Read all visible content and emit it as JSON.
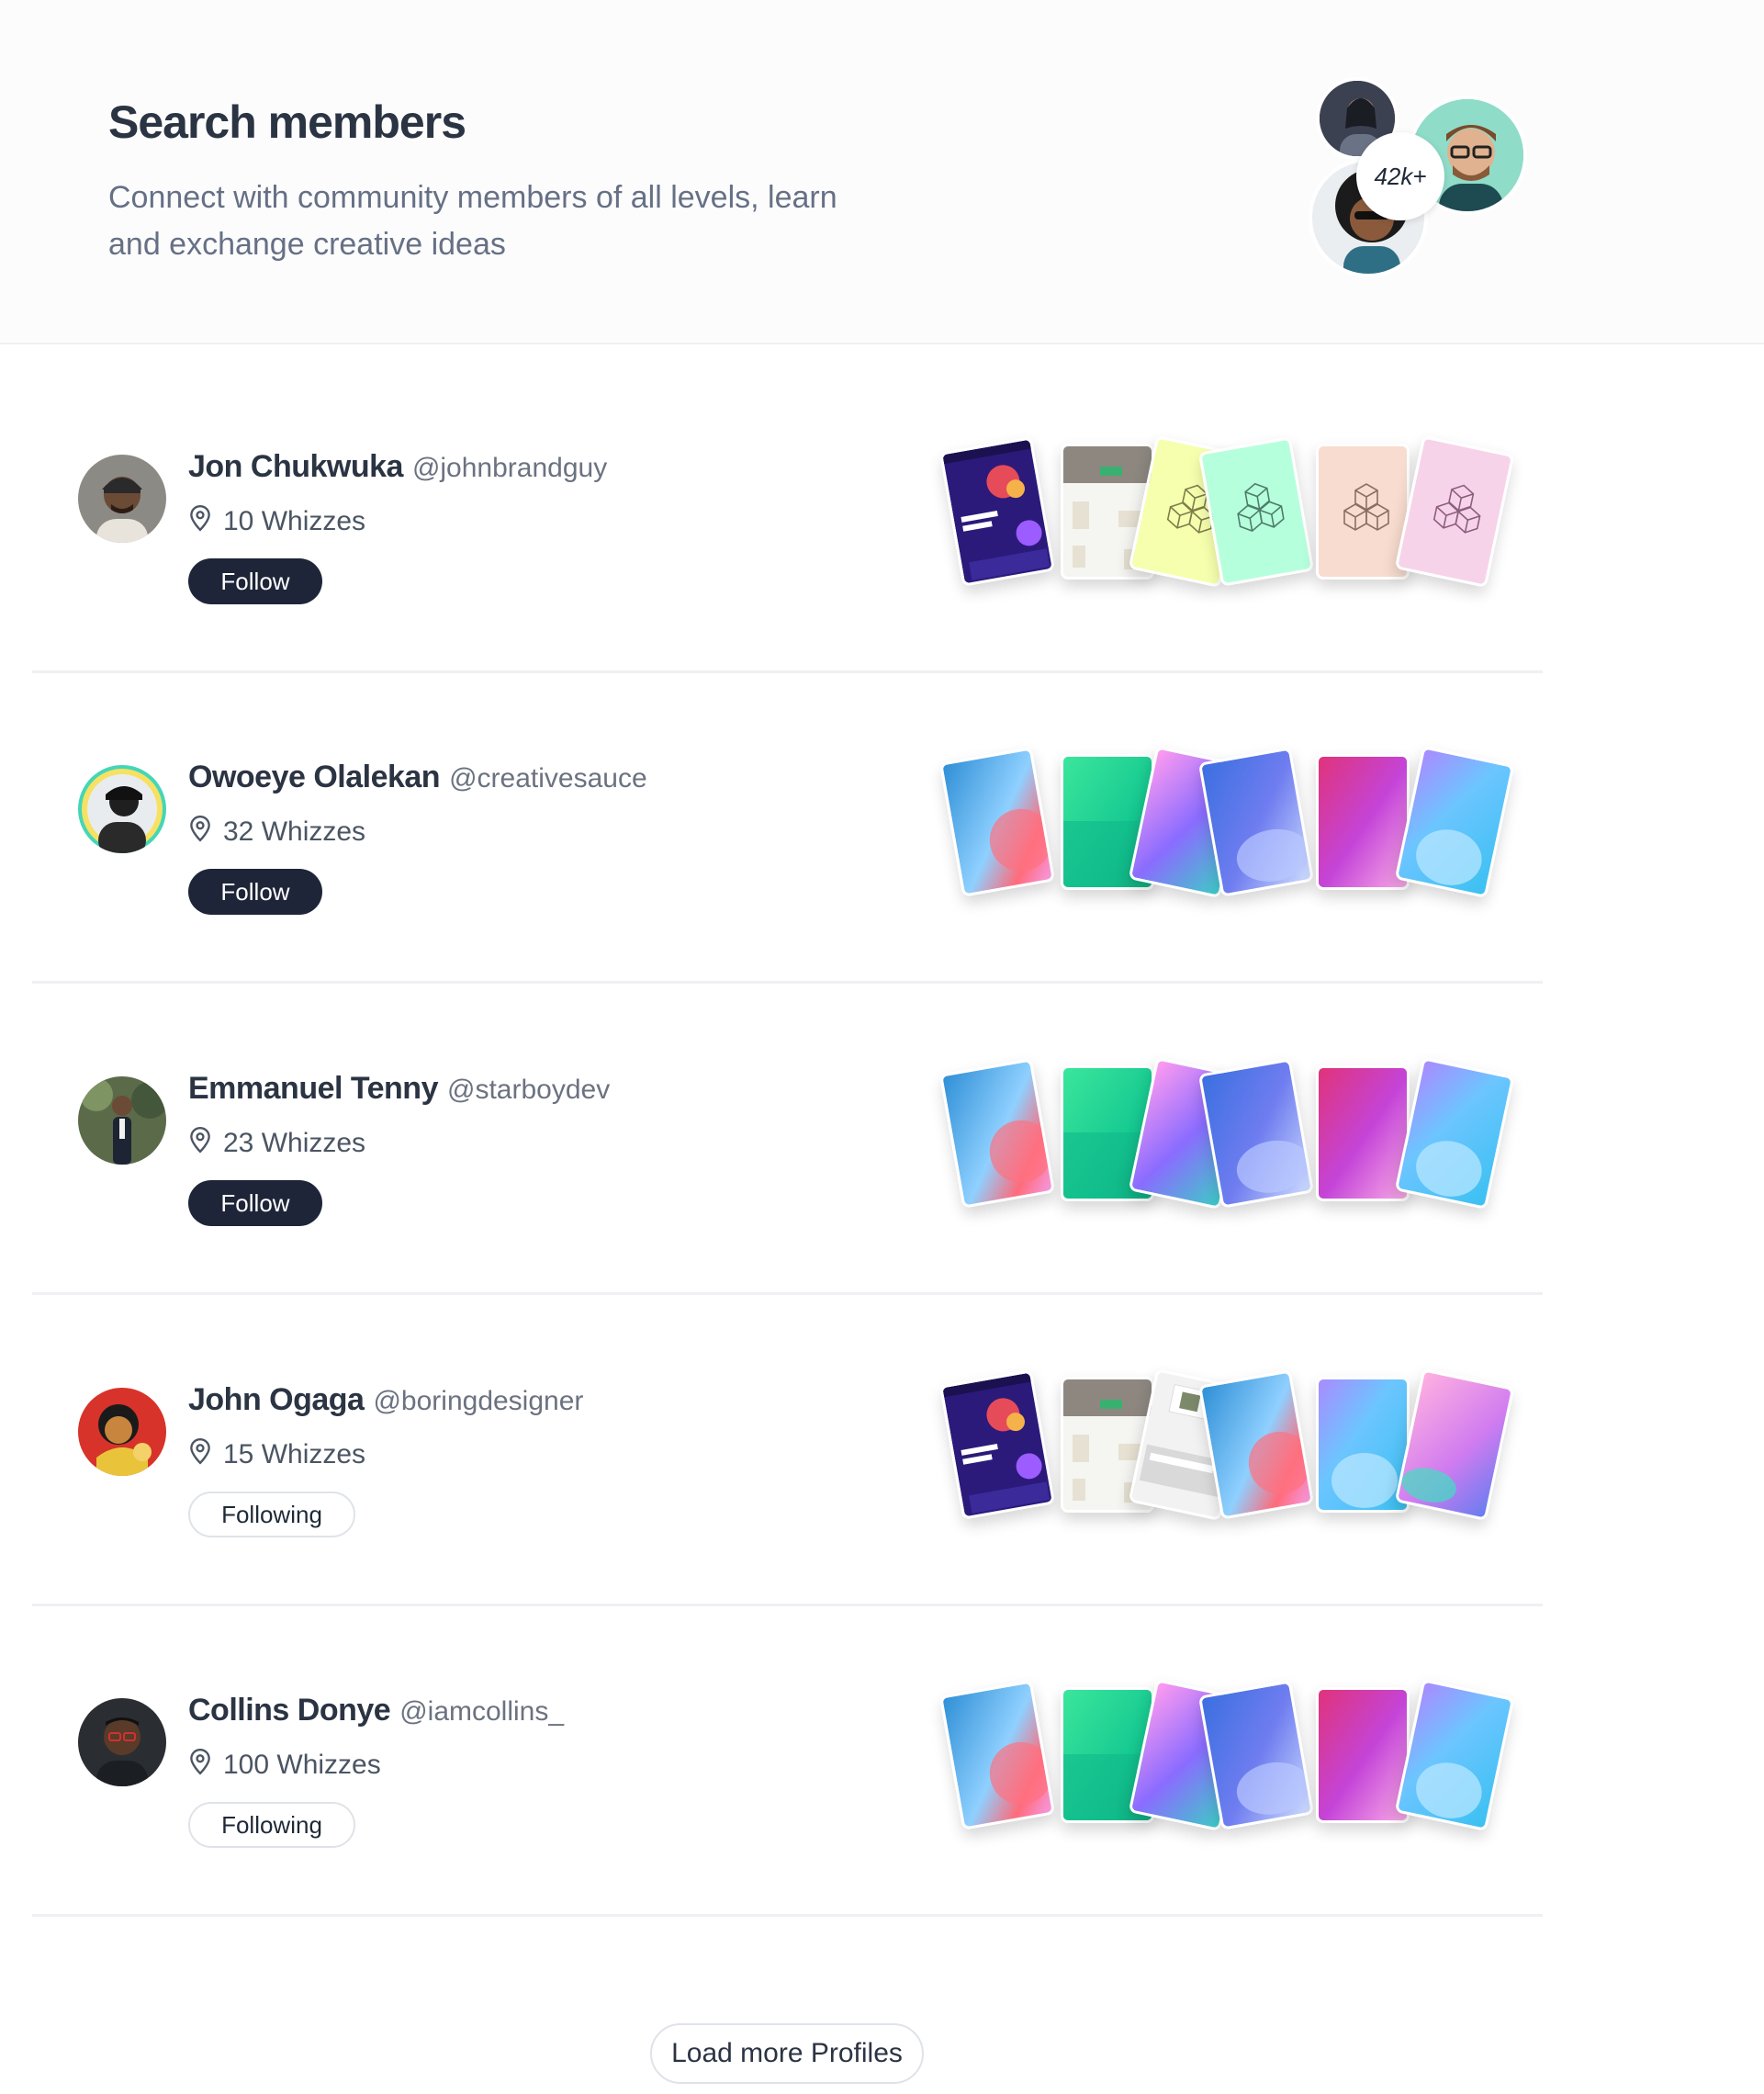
{
  "header": {
    "title": "Search members",
    "subtitle": "Connect with community members of all levels, learn and exchange creative ideas",
    "members_count": "42k+"
  },
  "members": [
    {
      "name": "Jon Chukwuka",
      "handle": "@johnbrandguy",
      "whizzes": "10 Whizzes",
      "action": "Follow",
      "cards": [
        "screenshot-purple",
        "screenshot-gray",
        "cube-yellow",
        "cube-mint",
        "cube-peach",
        "cube-pink"
      ]
    },
    {
      "name": "Owoeye Olalekan",
      "handle": "@creativesauce",
      "whizzes": "32 Whizzes",
      "action": "Follow",
      "cards": [
        "grad-blue-coral",
        "grad-green",
        "grad-violet-pink",
        "grad-indigo",
        "grad-magenta",
        "grad-sky"
      ]
    },
    {
      "name": "Emmanuel Tenny",
      "handle": "@starboydev",
      "whizzes": "23 Whizzes",
      "action": "Follow",
      "cards": [
        "grad-blue-coral",
        "grad-green",
        "grad-violet-pink",
        "grad-indigo",
        "grad-magenta",
        "grad-sky"
      ]
    },
    {
      "name": "John Ogaga",
      "handle": "@boringdesigner",
      "whizzes": "15 Whizzes",
      "action": "Following",
      "cards": [
        "screenshot-purple",
        "screenshot-gray",
        "screenshot-light",
        "grad-blue-coral",
        "grad-sky",
        "grad-pink-violet"
      ]
    },
    {
      "name": "Collins Donye",
      "handle": "@iamcollins_",
      "whizzes": "100 Whizzes",
      "action": "Following",
      "cards": [
        "grad-blue-coral",
        "grad-green",
        "grad-violet-pink",
        "grad-indigo",
        "grad-magenta",
        "grad-sky"
      ]
    }
  ],
  "load_more_label": "Load more Profiles",
  "icons": {
    "location": "location-pin-icon"
  },
  "colors": {
    "primary_button": "#1e2538",
    "text_dark": "#2b3443",
    "text_muted": "#667085",
    "divider": "#eef0f3"
  }
}
